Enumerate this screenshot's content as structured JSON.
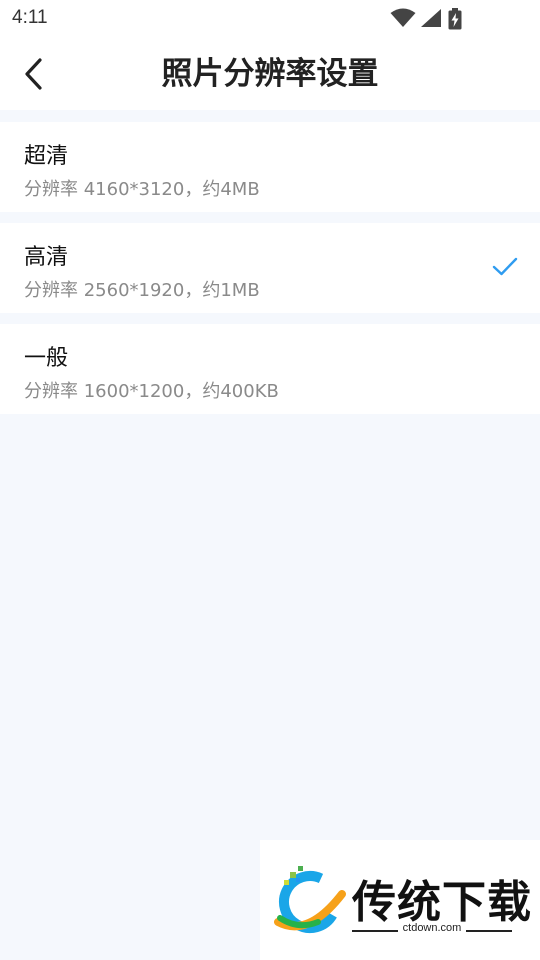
{
  "status_bar": {
    "time": "4:11",
    "icons": [
      "wifi-icon",
      "cell-signal-icon",
      "battery-charging-icon"
    ]
  },
  "header": {
    "back_icon": "chevron-left-icon",
    "title": "照片分辨率设置"
  },
  "options": [
    {
      "label": "超清",
      "description": "分辨率 4160*3120，约4MB",
      "selected": false
    },
    {
      "label": "高清",
      "description": "分辨率 2560*1920，约1MB",
      "selected": true
    },
    {
      "label": "一般",
      "description": "分辨率 1600*1200，约400KB",
      "selected": false
    }
  ],
  "colors": {
    "accent": "#2f9cf0",
    "background": "#f5f8fd",
    "card": "#ffffff",
    "secondary_text": "#8a8a8a"
  },
  "watermark": {
    "brand": "传统下载",
    "domain": "ctdown.com"
  }
}
